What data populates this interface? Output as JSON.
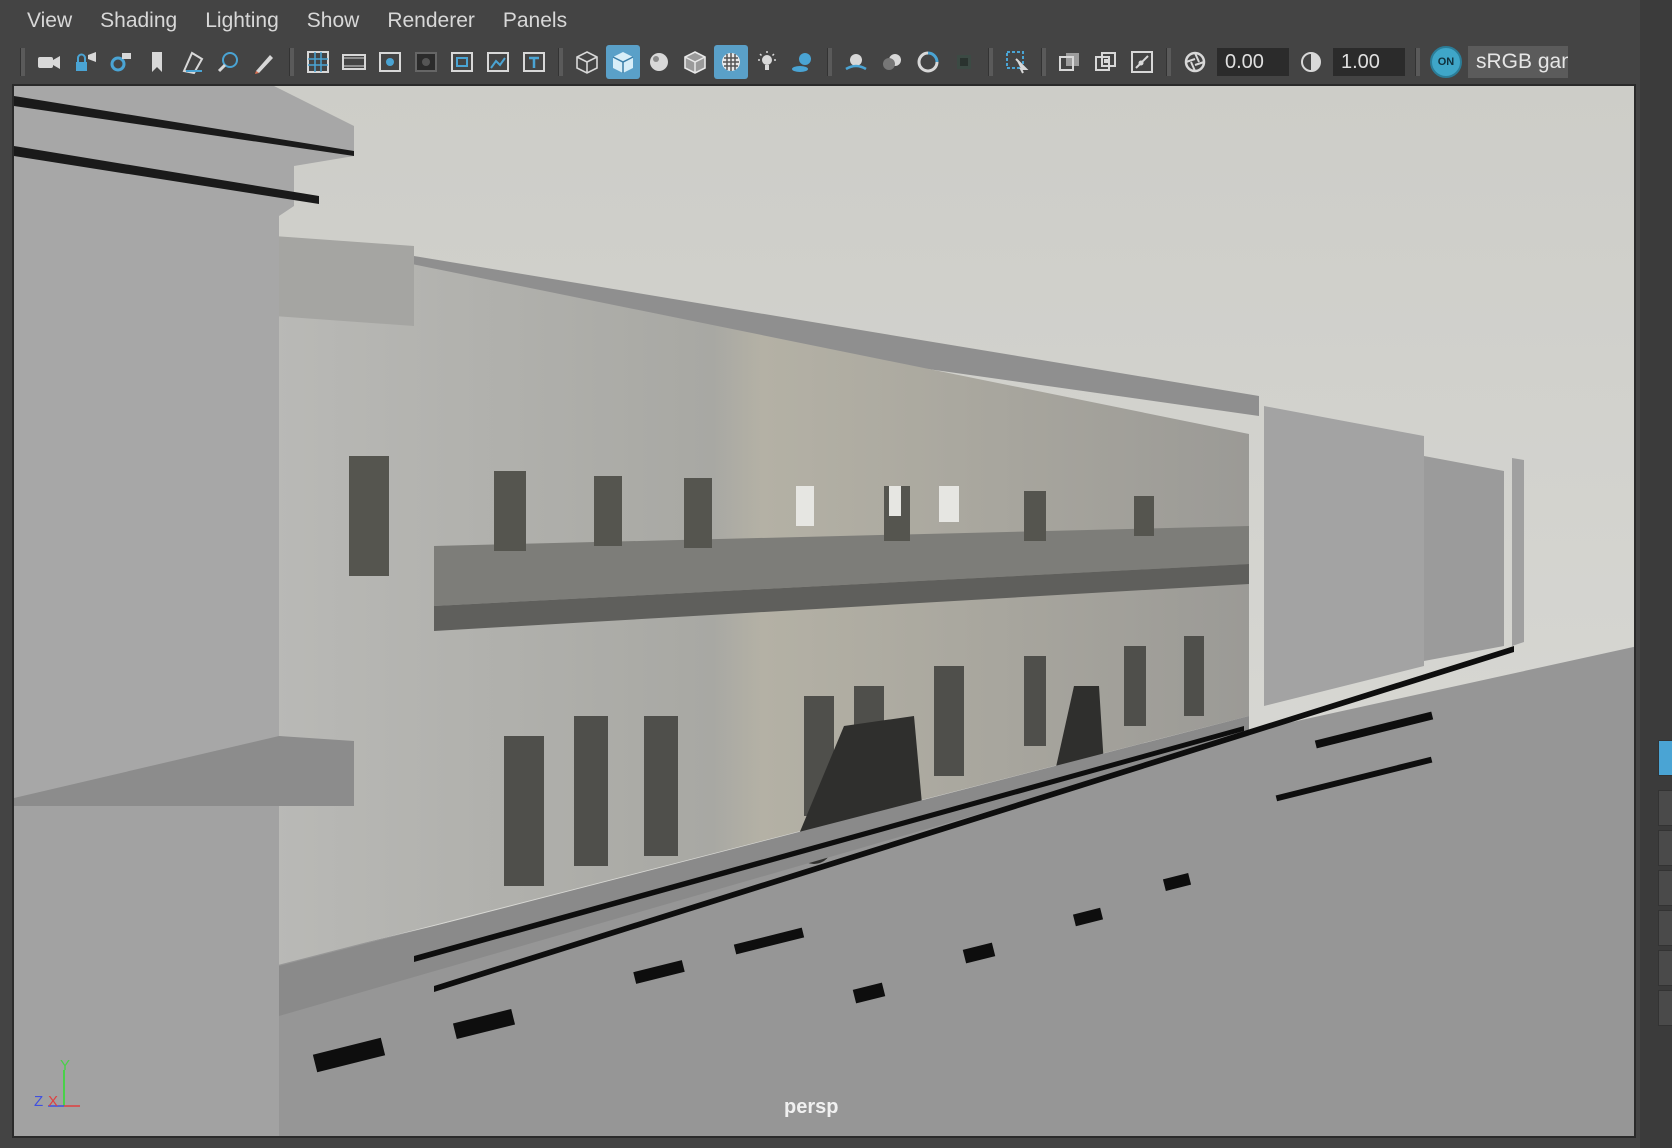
{
  "menu": [
    "View",
    "Shading",
    "Lighting",
    "Show",
    "Renderer",
    "Panels"
  ],
  "toolbar": {
    "exposure_value": "0.00",
    "gamma_value": "1.00",
    "color_management_badge": "ON",
    "color_space": "sRGB gam"
  },
  "viewport": {
    "camera_label": "persp",
    "axis_labels": {
      "y": "Y",
      "z": "Z",
      "x": "X"
    }
  },
  "colors": {
    "ui_background": "#444444",
    "active_button": "#5aa0c8",
    "sky": "#d6d6d2",
    "ground": "#969696",
    "block": "#a9a9a9"
  },
  "icons": [
    "camera-icon",
    "camera-lock-icon",
    "camera-attributes-icon",
    "bookmark-icon",
    "image-plane-icon",
    "2d-pan-zoom-icon",
    "grease-pencil-icon",
    "grid-icon",
    "film-gate-icon",
    "resolution-gate-icon",
    "gate-mask-icon",
    "field-chart-icon",
    "safe-action-icon",
    "safe-title-icon",
    "wireframe-icon",
    "smooth-shade-icon",
    "default-material-icon",
    "wireframe-on-shaded-icon",
    "textured-icon",
    "use-all-lights-icon",
    "shadows-icon",
    "screen-space-ao-icon",
    "motion-blur-icon",
    "anti-aliasing-icon",
    "depth-of-field-icon",
    "isolate-select-icon",
    "xray-icon",
    "xray-active-components-icon",
    "xray-joints-icon",
    "exposure-icon",
    "gamma-icon"
  ]
}
